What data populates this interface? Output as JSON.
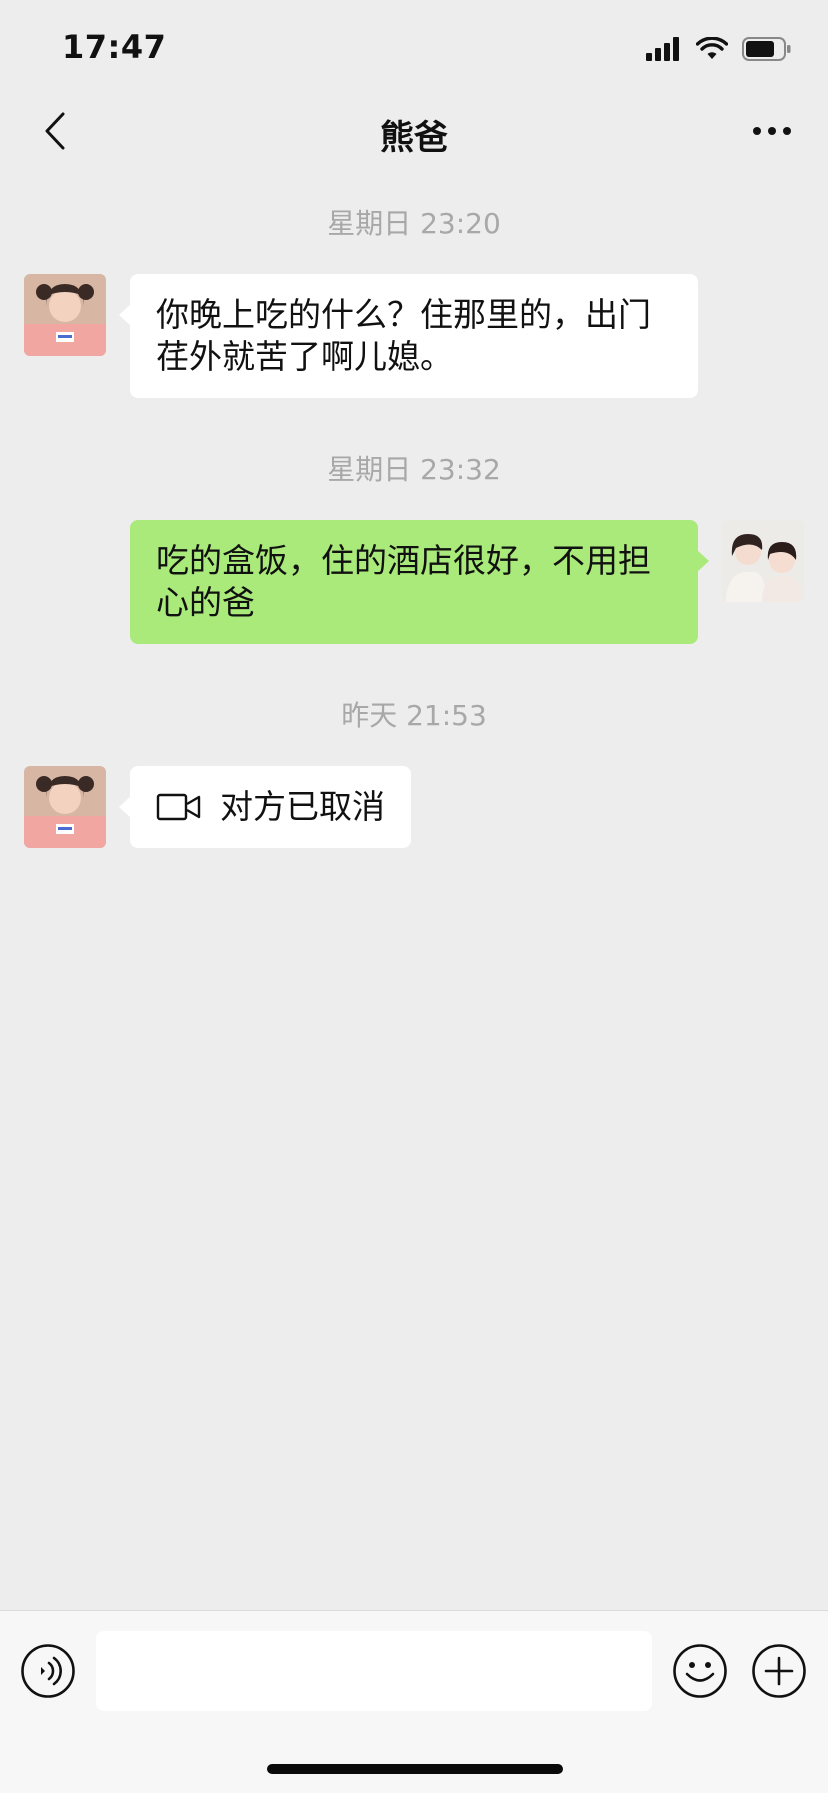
{
  "status_bar": {
    "time": "17:47"
  },
  "nav": {
    "title": "熊爸"
  },
  "messages": [
    {
      "timestamp": "星期日 23:20",
      "direction": "incoming",
      "text": "你晚上吃的什么？住那里的，出门荏外就苦了啊儿媳。"
    },
    {
      "timestamp": "星期日 23:32",
      "direction": "outgoing",
      "text": "吃的盒饭，住的酒店很好，不用担心的爸"
    },
    {
      "timestamp": "昨天 21:53",
      "direction": "incoming",
      "type": "video-call",
      "text": "对方已取消"
    }
  ],
  "input": {
    "value": "",
    "placeholder": ""
  },
  "colors": {
    "background": "#ededed",
    "outgoing_bubble": "#a9ea7a",
    "incoming_bubble": "#ffffff",
    "timestamp_text": "#a8a8a8"
  },
  "icons": {
    "back": "chevron-left-icon",
    "more": "more-dots-icon",
    "video_call": "video-camera-icon",
    "voice": "voice-icon",
    "emoji": "emoji-icon",
    "plus": "plus-icon"
  }
}
